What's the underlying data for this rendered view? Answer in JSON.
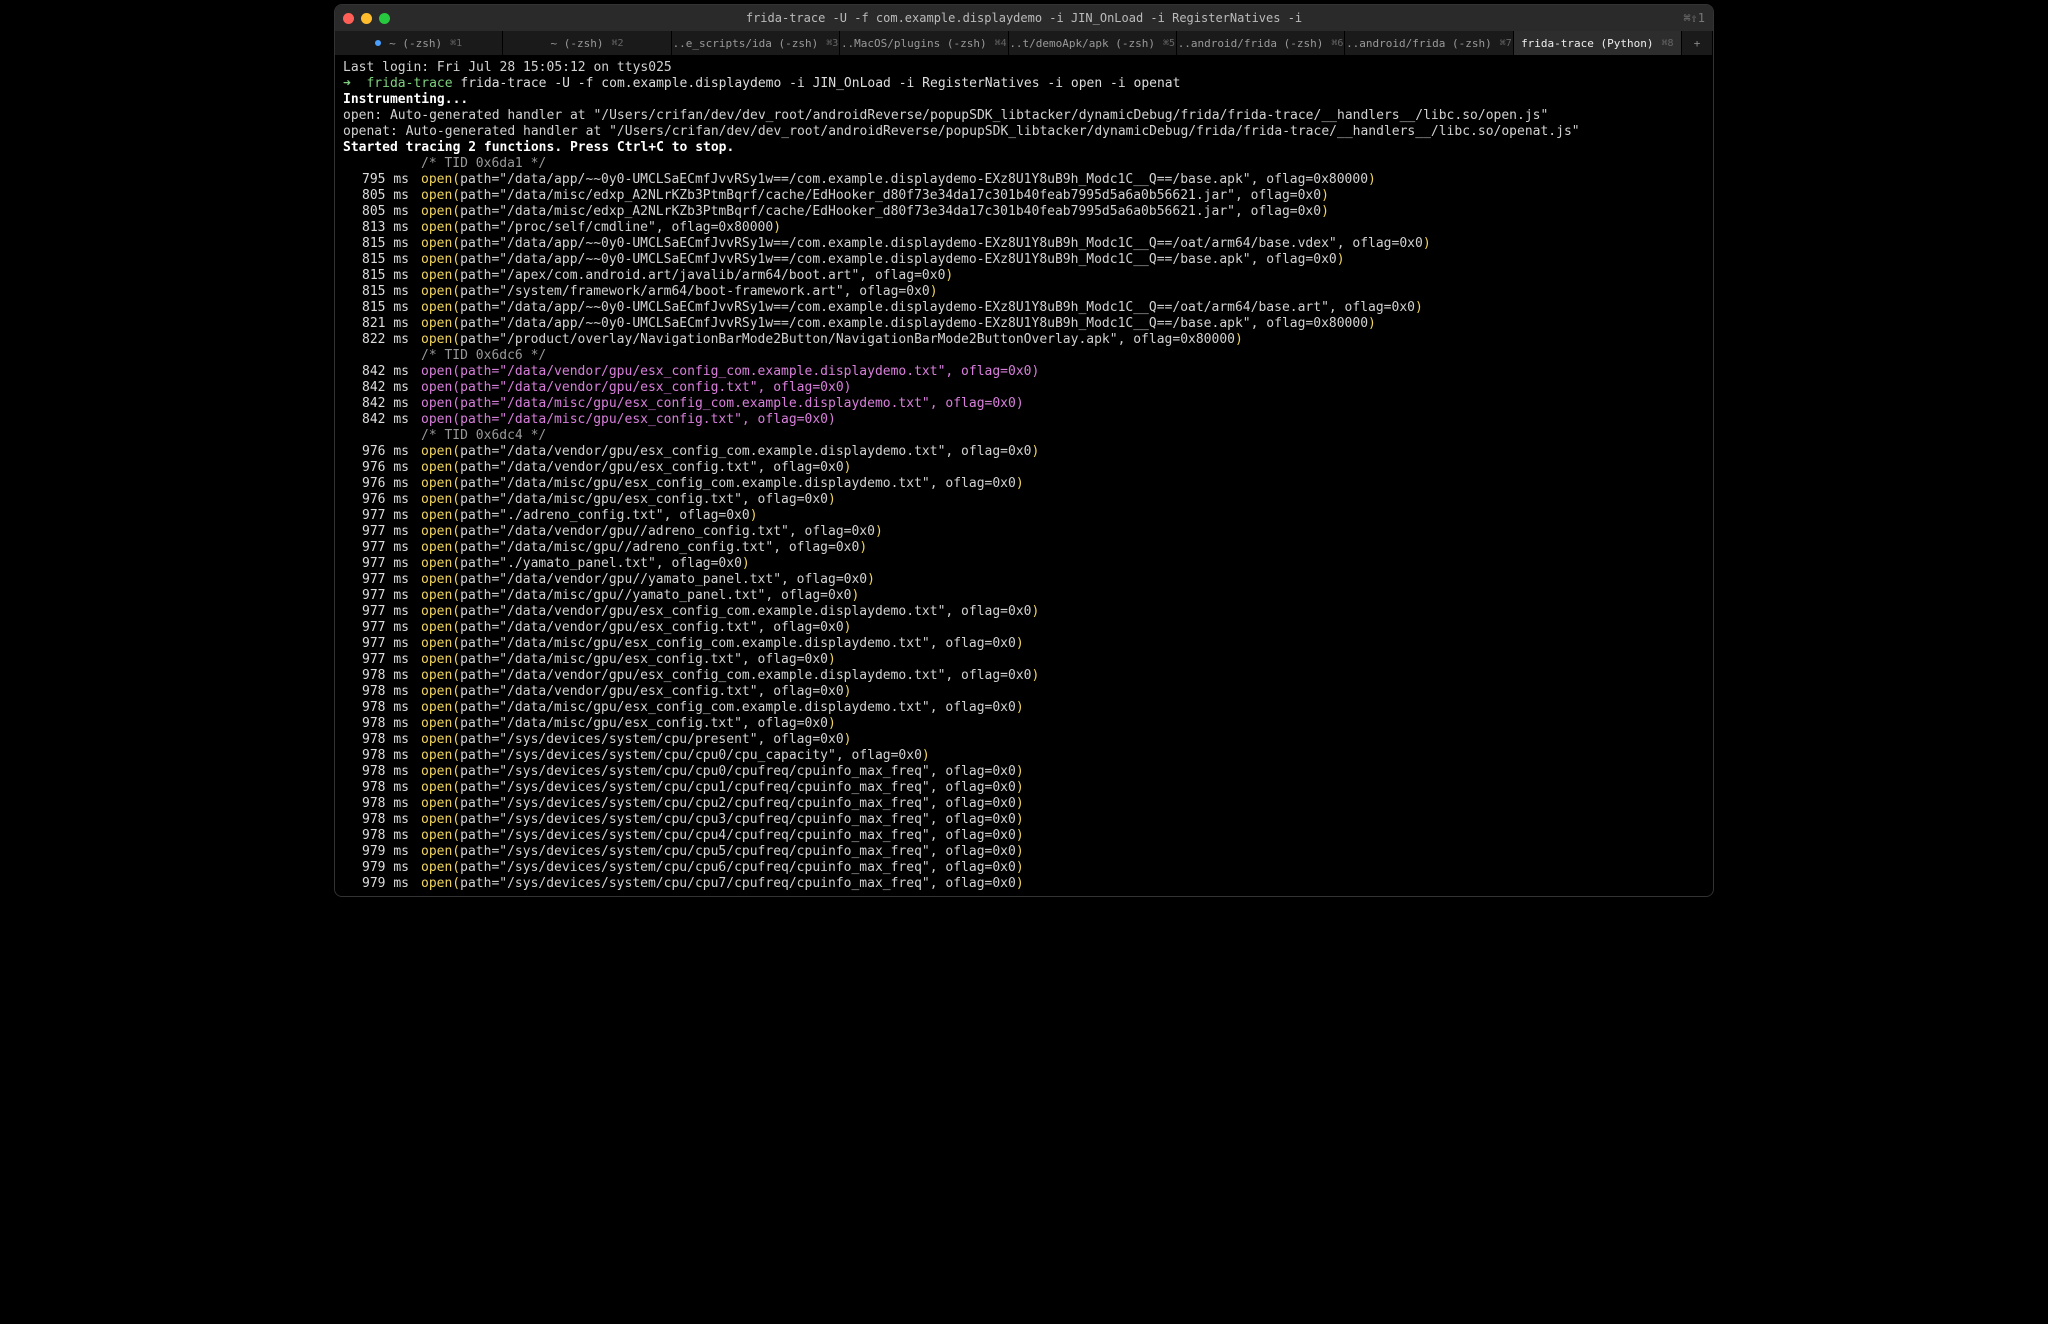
{
  "titlebar": {
    "title": "frida-trace -U -f com.example.displaydemo -i JIN_OnLoad -i RegisterNatives -i",
    "right": "⌘⇧1"
  },
  "tabs": [
    {
      "label": "~ (-zsh)",
      "sc": "⌘1",
      "dot": true
    },
    {
      "label": "~ (-zsh)",
      "sc": "⌘2"
    },
    {
      "label": "..e_scripts/ida (-zsh)",
      "sc": "⌘3"
    },
    {
      "label": "..MacOS/plugins (-zsh)",
      "sc": "⌘4"
    },
    {
      "label": "..t/demoApk/apk (-zsh)",
      "sc": "⌘5"
    },
    {
      "label": "..android/frida (-zsh)",
      "sc": "⌘6"
    },
    {
      "label": "..android/frida (-zsh)",
      "sc": "⌘7"
    },
    {
      "label": "frida-trace (Python)",
      "sc": "⌘8",
      "active": true
    }
  ],
  "header": {
    "last_login": "Last login: Fri Jul 28 15:05:12 on ttys025",
    "prompt_cmd_name": "frida-trace",
    "prompt_cmd_args": " frida-trace -U -f com.example.displaydemo -i JIN_OnLoad -i RegisterNatives -i open -i openat",
    "instrumenting": "Instrumenting...",
    "open_handler": "open: Auto-generated handler at \"/Users/crifan/dev/dev_root/androidReverse/popupSDK_libtacker/dynamicDebug/frida/frida-trace/__handlers__/libc.so/open.js\"",
    "openat_handler": "openat: Auto-generated handler at \"/Users/crifan/dev/dev_root/androidReverse/popupSDK_libtacker/dynamicDebug/frida/frida-trace/__handlers__/libc.so/openat.js\"",
    "started": "Started tracing 2 functions. Press Ctrl+C to stop."
  },
  "groups": [
    {
      "tid": "/* TID 0x6da1 */",
      "cls": "cyan",
      "rows": [
        {
          "ts": "795 ms",
          "txt": "open(path=\"/data/app/~~0y0-UMCLSaECmfJvvRSy1w==/com.example.displaydemo-EXz8U1Y8uB9h_Modc1C__Q==/base.apk\", oflag=0x80000)"
        },
        {
          "ts": "805 ms",
          "txt": "open(path=\"/data/misc/edxp_A2NLrKZb3PtmBqrf/cache/EdHooker_d80f73e34da17c301b40feab7995d5a6a0b56621.jar\", oflag=0x0)"
        },
        {
          "ts": "805 ms",
          "txt": "open(path=\"/data/misc/edxp_A2NLrKZb3PtmBqrf/cache/EdHooker_d80f73e34da17c301b40feab7995d5a6a0b56621.jar\", oflag=0x0)"
        },
        {
          "ts": "813 ms",
          "txt": "open(path=\"/proc/self/cmdline\", oflag=0x80000)"
        },
        {
          "ts": "815 ms",
          "txt": "open(path=\"/data/app/~~0y0-UMCLSaECmfJvvRSy1w==/com.example.displaydemo-EXz8U1Y8uB9h_Modc1C__Q==/oat/arm64/base.vdex\", oflag=0x0)"
        },
        {
          "ts": "815 ms",
          "txt": "open(path=\"/data/app/~~0y0-UMCLSaECmfJvvRSy1w==/com.example.displaydemo-EXz8U1Y8uB9h_Modc1C__Q==/base.apk\", oflag=0x0)"
        },
        {
          "ts": "815 ms",
          "txt": "open(path=\"/apex/com.android.art/javalib/arm64/boot.art\", oflag=0x0)"
        },
        {
          "ts": "815 ms",
          "txt": "open(path=\"/system/framework/arm64/boot-framework.art\", oflag=0x0)"
        },
        {
          "ts": "815 ms",
          "txt": "open(path=\"/data/app/~~0y0-UMCLSaECmfJvvRSy1w==/com.example.displaydemo-EXz8U1Y8uB9h_Modc1C__Q==/oat/arm64/base.art\", oflag=0x0)"
        },
        {
          "ts": "821 ms",
          "txt": "open(path=\"/data/app/~~0y0-UMCLSaECmfJvvRSy1w==/com.example.displaydemo-EXz8U1Y8uB9h_Modc1C__Q==/base.apk\", oflag=0x80000)"
        },
        {
          "ts": "822 ms",
          "txt": "open(path=\"/product/overlay/NavigationBarMode2Button/NavigationBarMode2ButtonOverlay.apk\", oflag=0x80000)"
        }
      ]
    },
    {
      "tid": "/* TID 0x6dc6 */",
      "cls": "mag",
      "rows": [
        {
          "ts": "842 ms",
          "txt": "open(path=\"/data/vendor/gpu/esx_config_com.example.displaydemo.txt\", oflag=0x0)"
        },
        {
          "ts": "842 ms",
          "txt": "open(path=\"/data/vendor/gpu/esx_config.txt\", oflag=0x0)"
        },
        {
          "ts": "842 ms",
          "txt": "open(path=\"/data/misc/gpu/esx_config_com.example.displaydemo.txt\", oflag=0x0)"
        },
        {
          "ts": "842 ms",
          "txt": "open(path=\"/data/misc/gpu/esx_config.txt\", oflag=0x0)"
        }
      ]
    },
    {
      "tid": "/* TID 0x6dc4 */",
      "cls": "",
      "rows": [
        {
          "ts": "976 ms",
          "txt": "open(path=\"/data/vendor/gpu/esx_config_com.example.displaydemo.txt\", oflag=0x0)"
        },
        {
          "ts": "976 ms",
          "txt": "open(path=\"/data/vendor/gpu/esx_config.txt\", oflag=0x0)"
        },
        {
          "ts": "976 ms",
          "txt": "open(path=\"/data/misc/gpu/esx_config_com.example.displaydemo.txt\", oflag=0x0)"
        },
        {
          "ts": "976 ms",
          "txt": "open(path=\"/data/misc/gpu/esx_config.txt\", oflag=0x0)"
        },
        {
          "ts": "977 ms",
          "txt": "open(path=\"./adreno_config.txt\", oflag=0x0)"
        },
        {
          "ts": "977 ms",
          "txt": "open(path=\"/data/vendor/gpu//adreno_config.txt\", oflag=0x0)"
        },
        {
          "ts": "977 ms",
          "txt": "open(path=\"/data/misc/gpu//adreno_config.txt\", oflag=0x0)"
        },
        {
          "ts": "977 ms",
          "txt": "open(path=\"./yamato_panel.txt\", oflag=0x0)"
        },
        {
          "ts": "977 ms",
          "txt": "open(path=\"/data/vendor/gpu//yamato_panel.txt\", oflag=0x0)"
        },
        {
          "ts": "977 ms",
          "txt": "open(path=\"/data/misc/gpu//yamato_panel.txt\", oflag=0x0)"
        },
        {
          "ts": "977 ms",
          "txt": "open(path=\"/data/vendor/gpu/esx_config_com.example.displaydemo.txt\", oflag=0x0)"
        },
        {
          "ts": "977 ms",
          "txt": "open(path=\"/data/vendor/gpu/esx_config.txt\", oflag=0x0)"
        },
        {
          "ts": "977 ms",
          "txt": "open(path=\"/data/misc/gpu/esx_config_com.example.displaydemo.txt\", oflag=0x0)"
        },
        {
          "ts": "977 ms",
          "txt": "open(path=\"/data/misc/gpu/esx_config.txt\", oflag=0x0)"
        },
        {
          "ts": "978 ms",
          "txt": "open(path=\"/data/vendor/gpu/esx_config_com.example.displaydemo.txt\", oflag=0x0)"
        },
        {
          "ts": "978 ms",
          "txt": "open(path=\"/data/vendor/gpu/esx_config.txt\", oflag=0x0)"
        },
        {
          "ts": "978 ms",
          "txt": "open(path=\"/data/misc/gpu/esx_config_com.example.displaydemo.txt\", oflag=0x0)"
        },
        {
          "ts": "978 ms",
          "txt": "open(path=\"/data/misc/gpu/esx_config.txt\", oflag=0x0)"
        },
        {
          "ts": "978 ms",
          "txt": "open(path=\"/sys/devices/system/cpu/present\", oflag=0x0)"
        },
        {
          "ts": "978 ms",
          "txt": "open(path=\"/sys/devices/system/cpu/cpu0/cpu_capacity\", oflag=0x0)"
        },
        {
          "ts": "978 ms",
          "txt": "open(path=\"/sys/devices/system/cpu/cpu0/cpufreq/cpuinfo_max_freq\", oflag=0x0)"
        },
        {
          "ts": "978 ms",
          "txt": "open(path=\"/sys/devices/system/cpu/cpu1/cpufreq/cpuinfo_max_freq\", oflag=0x0)"
        },
        {
          "ts": "978 ms",
          "txt": "open(path=\"/sys/devices/system/cpu/cpu2/cpufreq/cpuinfo_max_freq\", oflag=0x0)"
        },
        {
          "ts": "978 ms",
          "txt": "open(path=\"/sys/devices/system/cpu/cpu3/cpufreq/cpuinfo_max_freq\", oflag=0x0)"
        },
        {
          "ts": "978 ms",
          "txt": "open(path=\"/sys/devices/system/cpu/cpu4/cpufreq/cpuinfo_max_freq\", oflag=0x0)"
        },
        {
          "ts": "979 ms",
          "txt": "open(path=\"/sys/devices/system/cpu/cpu5/cpufreq/cpuinfo_max_freq\", oflag=0x0)"
        },
        {
          "ts": "979 ms",
          "txt": "open(path=\"/sys/devices/system/cpu/cpu6/cpufreq/cpuinfo_max_freq\", oflag=0x0)"
        },
        {
          "ts": "979 ms",
          "txt": "open(path=\"/sys/devices/system/cpu/cpu7/cpufreq/cpuinfo_max_freq\", oflag=0x0)"
        }
      ]
    }
  ]
}
